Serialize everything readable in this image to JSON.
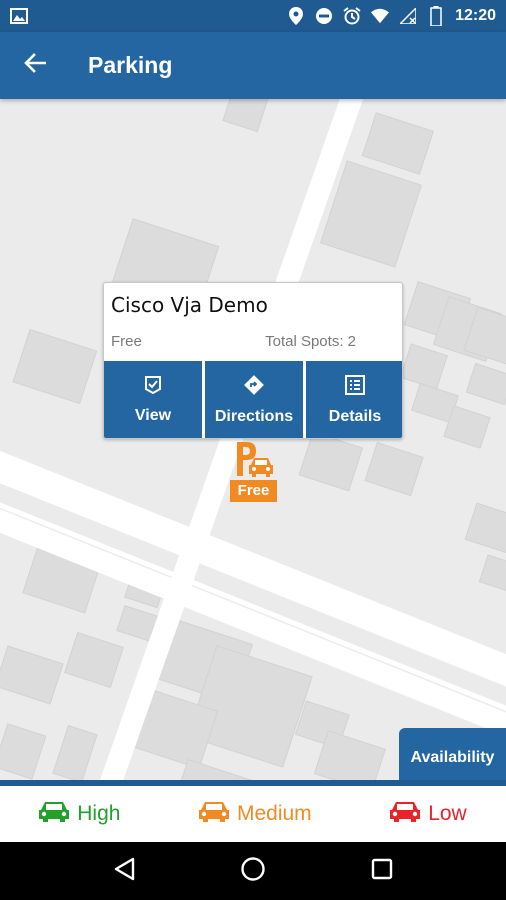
{
  "status_bar": {
    "time": "12:20",
    "icons": [
      "image-icon",
      "location-icon",
      "do-not-disturb-icon",
      "alarm-icon",
      "wifi-icon",
      "signal-icon",
      "battery-icon"
    ]
  },
  "app_bar": {
    "title": "Parking",
    "back_icon": "arrow-left-icon"
  },
  "popup": {
    "title": "Cisco Vja Demo",
    "price": "Free",
    "total_spots": "Total Spots: 2",
    "actions": [
      {
        "label": "View",
        "icon": "view-check-icon"
      },
      {
        "label": "Directions",
        "icon": "directions-icon"
      },
      {
        "label": "Details",
        "icon": "details-list-icon"
      }
    ]
  },
  "marker": {
    "label": "Free",
    "color": "#f28a23"
  },
  "availability_tab": {
    "label": "Availability"
  },
  "legend": [
    {
      "label": "High",
      "color": "#22a02b",
      "icon": "car-icon"
    },
    {
      "label": "Medium",
      "color": "#f28a23",
      "icon": "car-icon"
    },
    {
      "label": "Low",
      "color": "#e8232a",
      "icon": "car-icon"
    }
  ],
  "nav_bar": {
    "buttons": [
      "back-triangle-icon",
      "home-circle-icon",
      "recents-square-icon"
    ]
  },
  "colors": {
    "primary": "#2466a2",
    "status_bar": "#1f5a91"
  }
}
